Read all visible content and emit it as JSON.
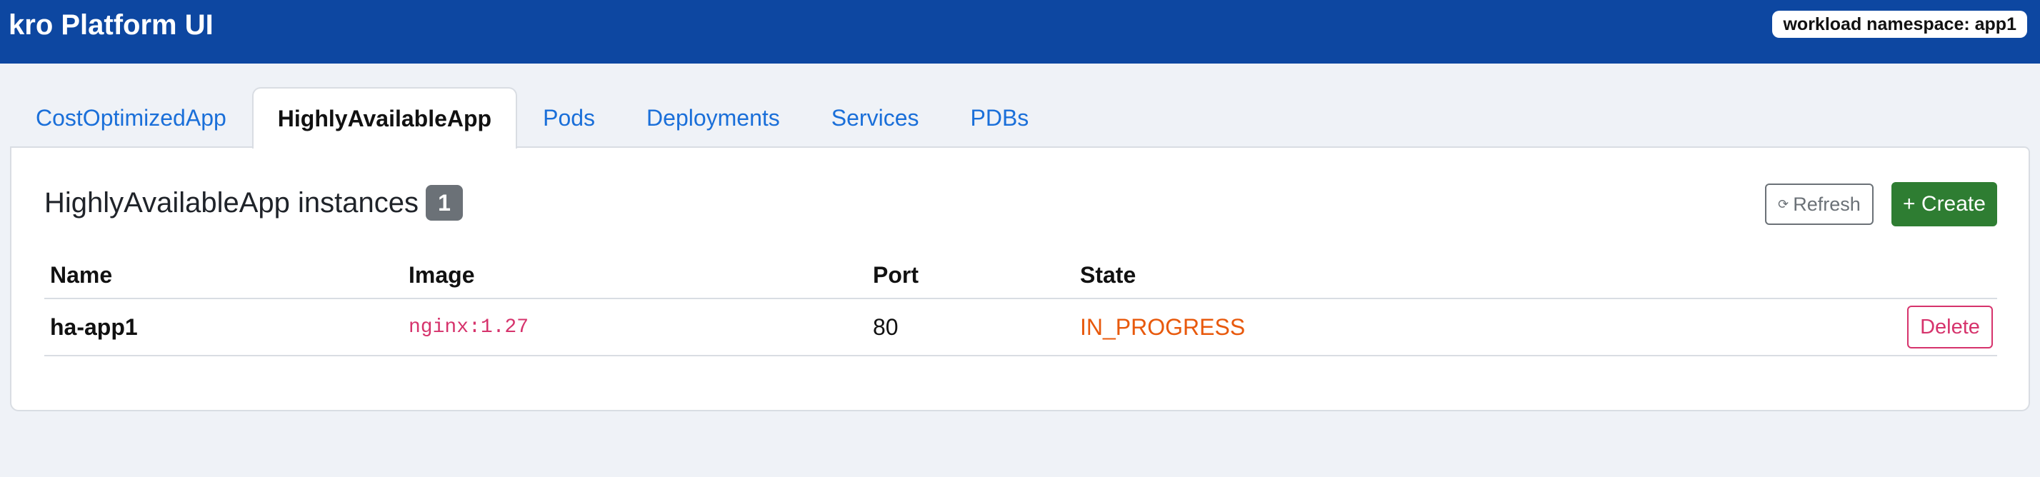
{
  "app": {
    "title": "kro Platform UI",
    "namespace_badge": "workload namespace: app1"
  },
  "tabs": [
    {
      "label": "CostOptimizedApp",
      "active": false
    },
    {
      "label": "HighlyAvailableApp",
      "active": true
    },
    {
      "label": "Pods",
      "active": false
    },
    {
      "label": "Deployments",
      "active": false
    },
    {
      "label": "Services",
      "active": false
    },
    {
      "label": "PDBs",
      "active": false
    }
  ],
  "panel": {
    "title": "HighlyAvailableApp instances",
    "count": "1",
    "refresh_label": "Refresh",
    "refresh_icon": "⟳",
    "create_label": "+ Create"
  },
  "table": {
    "columns": [
      "Name",
      "Image",
      "Port",
      "State"
    ],
    "rows": [
      {
        "name": "ha-app1",
        "image": "nginx:1.27",
        "port": "80",
        "state": "IN_PROGRESS",
        "delete_label": "Delete"
      }
    ]
  },
  "colors": {
    "header_bg": "#0d47a1",
    "link": "#1a6fd9",
    "create_button": "#2e7d32",
    "state_in_progress": "#e8590c",
    "danger": "#d6336c",
    "badge_gray": "#6b7177"
  },
  "icons": {
    "refresh": "refresh-icon"
  }
}
